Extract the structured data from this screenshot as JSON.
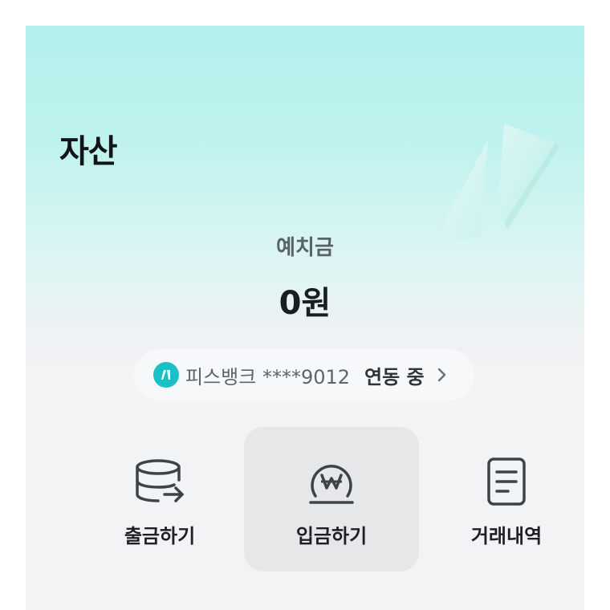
{
  "header": {
    "title": "자산"
  },
  "balance": {
    "label": "예치금",
    "amount": "0원"
  },
  "linked_account": {
    "bank_text": "피스뱅크 ****9012",
    "status": "연동 중",
    "logo_icon": "bank-logo-icon",
    "logo_color": "#1bbfc5"
  },
  "actions": [
    {
      "label": "출금하기",
      "icon": "withdraw-icon"
    },
    {
      "label": "입금하기",
      "icon": "deposit-won-icon",
      "selected": true
    },
    {
      "label": "거래내역",
      "icon": "document-icon"
    }
  ],
  "colors": {
    "accent": "#1bbfc5",
    "background_top": "#b4f0ec",
    "background_bottom": "#f2f3f5"
  }
}
